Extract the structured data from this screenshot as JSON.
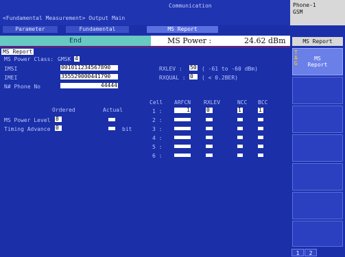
{
  "header": {
    "breadcrumb": "<Fundamental Measurement> Output Main",
    "mode": "Communication",
    "tabs": [
      "Parameter",
      "Fundamental",
      "MS Report"
    ],
    "phone_line1": "Phone-1",
    "phone_line2": "GSM"
  },
  "status": {
    "end_label": "End",
    "ms_power_label": "MS Power :",
    "ms_power_value": "24.62 dBm"
  },
  "ms_report": {
    "title": "MS Report",
    "power_class_label": "MS Power Class:",
    "power_class_value": "GMSK",
    "power_class_num": "4",
    "imsi_label": "IMSI",
    "imsi_value": "001011234567890",
    "imei_label": "IMEI",
    "imei_value": "355529000441790",
    "phone_no_label": "N# Phone No",
    "phone_no_value": "44444",
    "rxlev_label": "RXLEV :",
    "rxlev_value": "50",
    "rxlev_range": "( -61 to -60 dBm)",
    "rxqual_label": "RXQUAL :",
    "rxqual_value": "0",
    "rxqual_range": "(    < 0.2BER)",
    "ordered_label": "Ordered",
    "actual_label": "Actual",
    "ms_power_level_label": "MS Power Level :",
    "ms_power_level_ordered": "8",
    "timing_advance_label": "Timing Advance :",
    "timing_advance_ordered": "0",
    "timing_advance_unit": "bit"
  },
  "cell_table": {
    "headers": [
      "Cell",
      "ARFCN",
      "RXLEV",
      "NCC",
      "BCC"
    ],
    "rows": [
      {
        "cell": "1 :",
        "arfcn": "1",
        "rxlev": "0",
        "ncc": "1",
        "bcc": "1"
      },
      {
        "cell": "2 :",
        "arfcn": "",
        "rxlev": "",
        "ncc": "",
        "bcc": ""
      },
      {
        "cell": "3 :",
        "arfcn": "",
        "rxlev": "",
        "ncc": "",
        "bcc": ""
      },
      {
        "cell": "4 :",
        "arfcn": "",
        "rxlev": "",
        "ncc": "",
        "bcc": ""
      },
      {
        "cell": "5 :",
        "arfcn": "",
        "rxlev": "",
        "ncc": "",
        "bcc": ""
      },
      {
        "cell": "6 :",
        "arfcn": "",
        "rxlev": "",
        "ncc": "",
        "bcc": ""
      }
    ]
  },
  "side_panel": {
    "title": "MS Report",
    "tag_letters": [
      "T",
      "A",
      "G"
    ],
    "button1_line1": "MS",
    "button1_line2": "Report",
    "page_tabs": [
      "1",
      "2"
    ]
  },
  "colors": {
    "background": "#1a2fa8",
    "end_bar": "#67c9c2",
    "accent_red": "#c0123a"
  }
}
